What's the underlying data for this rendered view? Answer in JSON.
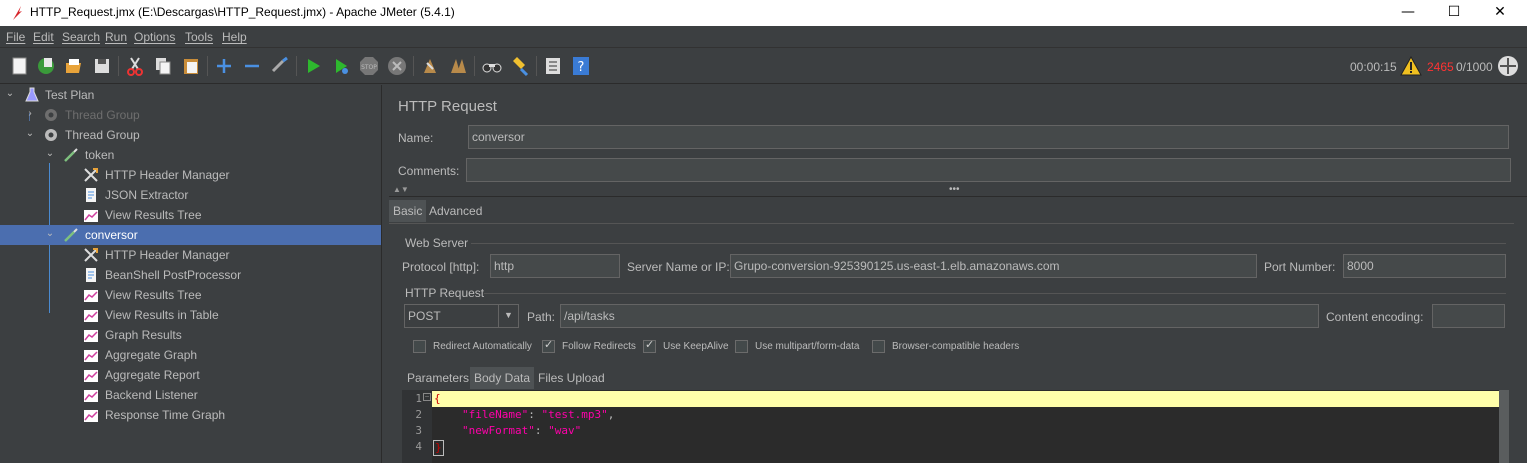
{
  "window": {
    "title": "HTTP_Request.jmx (E:\\Descargas\\HTTP_Request.jmx) - Apache JMeter (5.4.1)",
    "minimize": "—",
    "maximize": "☐",
    "close": "✕"
  },
  "menu": [
    "File",
    "Edit",
    "Search",
    "Run",
    "Options",
    "Tools",
    "Help"
  ],
  "status": {
    "elapsed": "00:00:15",
    "errors": "2465",
    "threads": "0/1000"
  },
  "tree": {
    "items": [
      {
        "label": "Test Plan",
        "icon": "flask-icon"
      },
      {
        "label": "Thread Group",
        "icon": "gear-icon"
      },
      {
        "label": "Thread Group",
        "icon": "gear-icon"
      },
      {
        "label": "token",
        "icon": "pipette-icon"
      },
      {
        "label": "HTTP Header Manager",
        "icon": "wrench-icon"
      },
      {
        "label": "JSON Extractor",
        "icon": "document-icon"
      },
      {
        "label": "View Results Tree",
        "icon": "chart-icon"
      },
      {
        "label": "conversor",
        "icon": "pipette-icon"
      },
      {
        "label": "HTTP Header Manager",
        "icon": "wrench-icon"
      },
      {
        "label": "BeanShell PostProcessor",
        "icon": "document-icon"
      },
      {
        "label": "View Results Tree",
        "icon": "chart-icon"
      },
      {
        "label": "View Results in Table",
        "icon": "chart-icon"
      },
      {
        "label": "Graph Results",
        "icon": "chart-icon"
      },
      {
        "label": "Aggregate Graph",
        "icon": "chart-icon"
      },
      {
        "label": "Aggregate Report",
        "icon": "chart-icon"
      },
      {
        "label": "Backend Listener",
        "icon": "chart-icon"
      },
      {
        "label": "Response Time Graph",
        "icon": "chart-icon"
      }
    ]
  },
  "panel": {
    "title": "HTTP Request",
    "name_label": "Name:",
    "name_value": "conversor",
    "comments_label": "Comments:",
    "comments_value": "",
    "tabs": [
      "Basic",
      "Advanced"
    ],
    "web_server": {
      "title": "Web Server",
      "protocol_label": "Protocol [http]:",
      "protocol_value": "http",
      "server_label": "Server Name or IP:",
      "server_value": "Grupo-conversion-925390125.us-east-1.elb.amazonaws.com",
      "port_label": "Port Number:",
      "port_value": "8000"
    },
    "http_request": {
      "title": "HTTP Request",
      "method": "POST",
      "path_label": "Path:",
      "path_value": "/api/tasks",
      "encoding_label": "Content encoding:",
      "encoding_value": ""
    },
    "checkboxes": [
      {
        "label": "Redirect Automatically",
        "checked": false
      },
      {
        "label": "Follow Redirects",
        "checked": true
      },
      {
        "label": "Use KeepAlive",
        "checked": true
      },
      {
        "label": "Use multipart/form-data",
        "checked": false
      },
      {
        "label": "Browser-compatible headers",
        "checked": false
      }
    ],
    "body_tabs": [
      "Parameters",
      "Body Data",
      "Files Upload"
    ],
    "body_lines": [
      {
        "num": "1",
        "text": "{"
      },
      {
        "num": "2",
        "key": "\"fileName\"",
        "sep": ": ",
        "val": "\"test.mp3\"",
        "end": ","
      },
      {
        "num": "3",
        "key": "\"newFormat\"",
        "sep": ": ",
        "val": "\"wav\"",
        "end": ""
      },
      {
        "num": "4",
        "text": "}"
      }
    ]
  },
  "colors": {
    "selection": "#4b6eaf",
    "error": "#ff3333",
    "editor_highlight": "#ffffaa",
    "json_key": "#ff00aa"
  }
}
